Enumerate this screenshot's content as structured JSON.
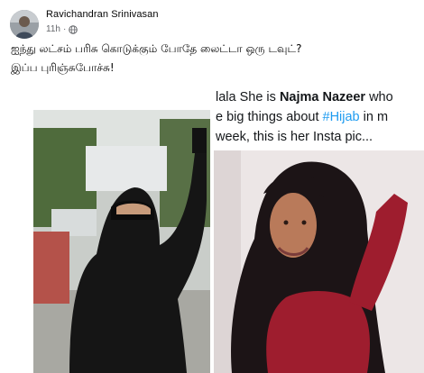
{
  "post": {
    "author": "Ravichandran Srinivasan",
    "timestamp": "11h",
    "separator": "·",
    "audience_icon": "globe-icon",
    "caption_lines": [
      "ஐந்து லட்சம் பரிசு கொடுக்கும் போதே லைட்டா ஒரு டவுட்?",
      "இப்ப புரிஞ்சுபோச்சு!"
    ]
  },
  "tweet": {
    "line1_pre": "lala She is ",
    "line1_name": "Najma Nazeer",
    "line1_post": " who",
    "line2_pre": "e big things about ",
    "line2_tag": "#Hijab",
    "line2_post": " in m",
    "line3": "week, this is her Insta pic..."
  },
  "colors": {
    "link": "#1d9bf0",
    "text": "#050505",
    "secondary": "#65676b"
  }
}
